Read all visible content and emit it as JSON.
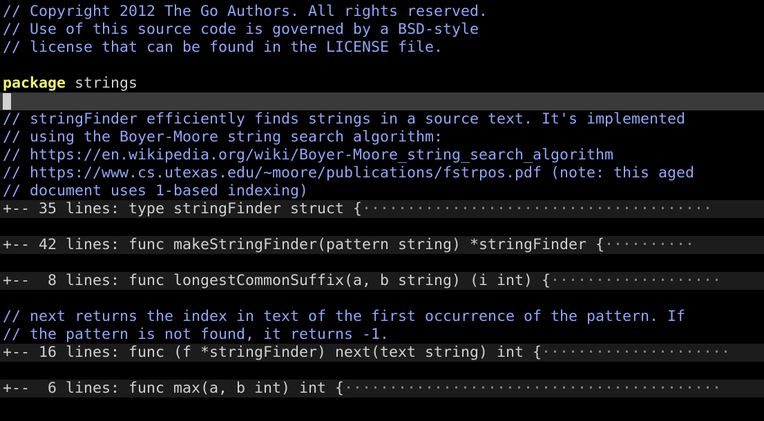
{
  "editor": {
    "header_comments": [
      "// Copyright 2012 The Go Authors. All rights reserved.",
      "// Use of this source code is governed by a BSD-style",
      "// license that can be found in the LICENSE file."
    ],
    "package_keyword": "package",
    "package_name": " strings",
    "finder_comments": [
      "// stringFinder efficiently finds strings in a source text. It's implemented",
      "// using the Boyer-Moore string search algorithm:",
      "// https://en.wikipedia.org/wiki/Boyer-Moore_string_search_algorithm",
      "// https://www.cs.utexas.edu/~moore/publications/fstrpos.pdf (note: this aged",
      "// document uses 1-based indexing)"
    ],
    "folds": [
      {
        "text": "+-- 35 lines: type stringFinder struct {",
        "dots": "·······································"
      },
      {
        "text": "+-- 42 lines: func makeStringFinder(pattern string) *stringFinder {",
        "dots": "··········"
      },
      {
        "text": "+--  8 lines: func longestCommonSuffix(a, b string) (i int) {",
        "dots": "···················"
      },
      {
        "text": "+-- 16 lines: func (f *stringFinder) next(text string) int {",
        "dots": "·····················"
      },
      {
        "text": "+--  6 lines: func max(a, b int) int {",
        "dots": "··········································"
      }
    ],
    "next_comments": [
      "// next returns the index in text of the first occurrence of the pattern. If",
      "// the pattern is not found, it returns -1."
    ],
    "colors": {
      "background": "#000000",
      "comment": "#8fa6f7",
      "keyword": "#f5f56b",
      "cursorline": "#3a3a3a",
      "fold_background": "#1c1c1c"
    }
  }
}
